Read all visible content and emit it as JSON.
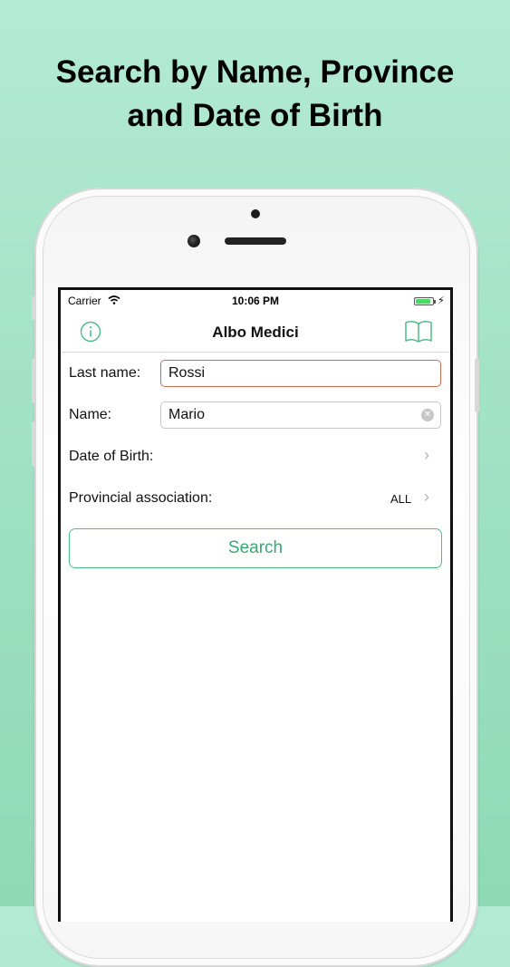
{
  "headline": {
    "line1": "Search by Name, Province",
    "line2": "and Date of Birth"
  },
  "status_bar": {
    "carrier": "Carrier",
    "time": "10:06 PM",
    "battery_level": 0.9
  },
  "nav": {
    "title": "Albo Medici",
    "left_icon": "info-icon",
    "right_icon": "book-icon"
  },
  "form": {
    "last_name": {
      "label": "Last name:",
      "value": "Rossi"
    },
    "name": {
      "label": "Name:",
      "value": "Mario"
    },
    "date_of_birth": {
      "label": "Date of Birth:"
    },
    "provincial_association": {
      "label": "Provincial association:",
      "value": "ALL"
    },
    "search_button": "Search"
  },
  "colors": {
    "accent": "#3aa874",
    "focused_border": "#c96a55",
    "background": "#a6e3c8"
  }
}
